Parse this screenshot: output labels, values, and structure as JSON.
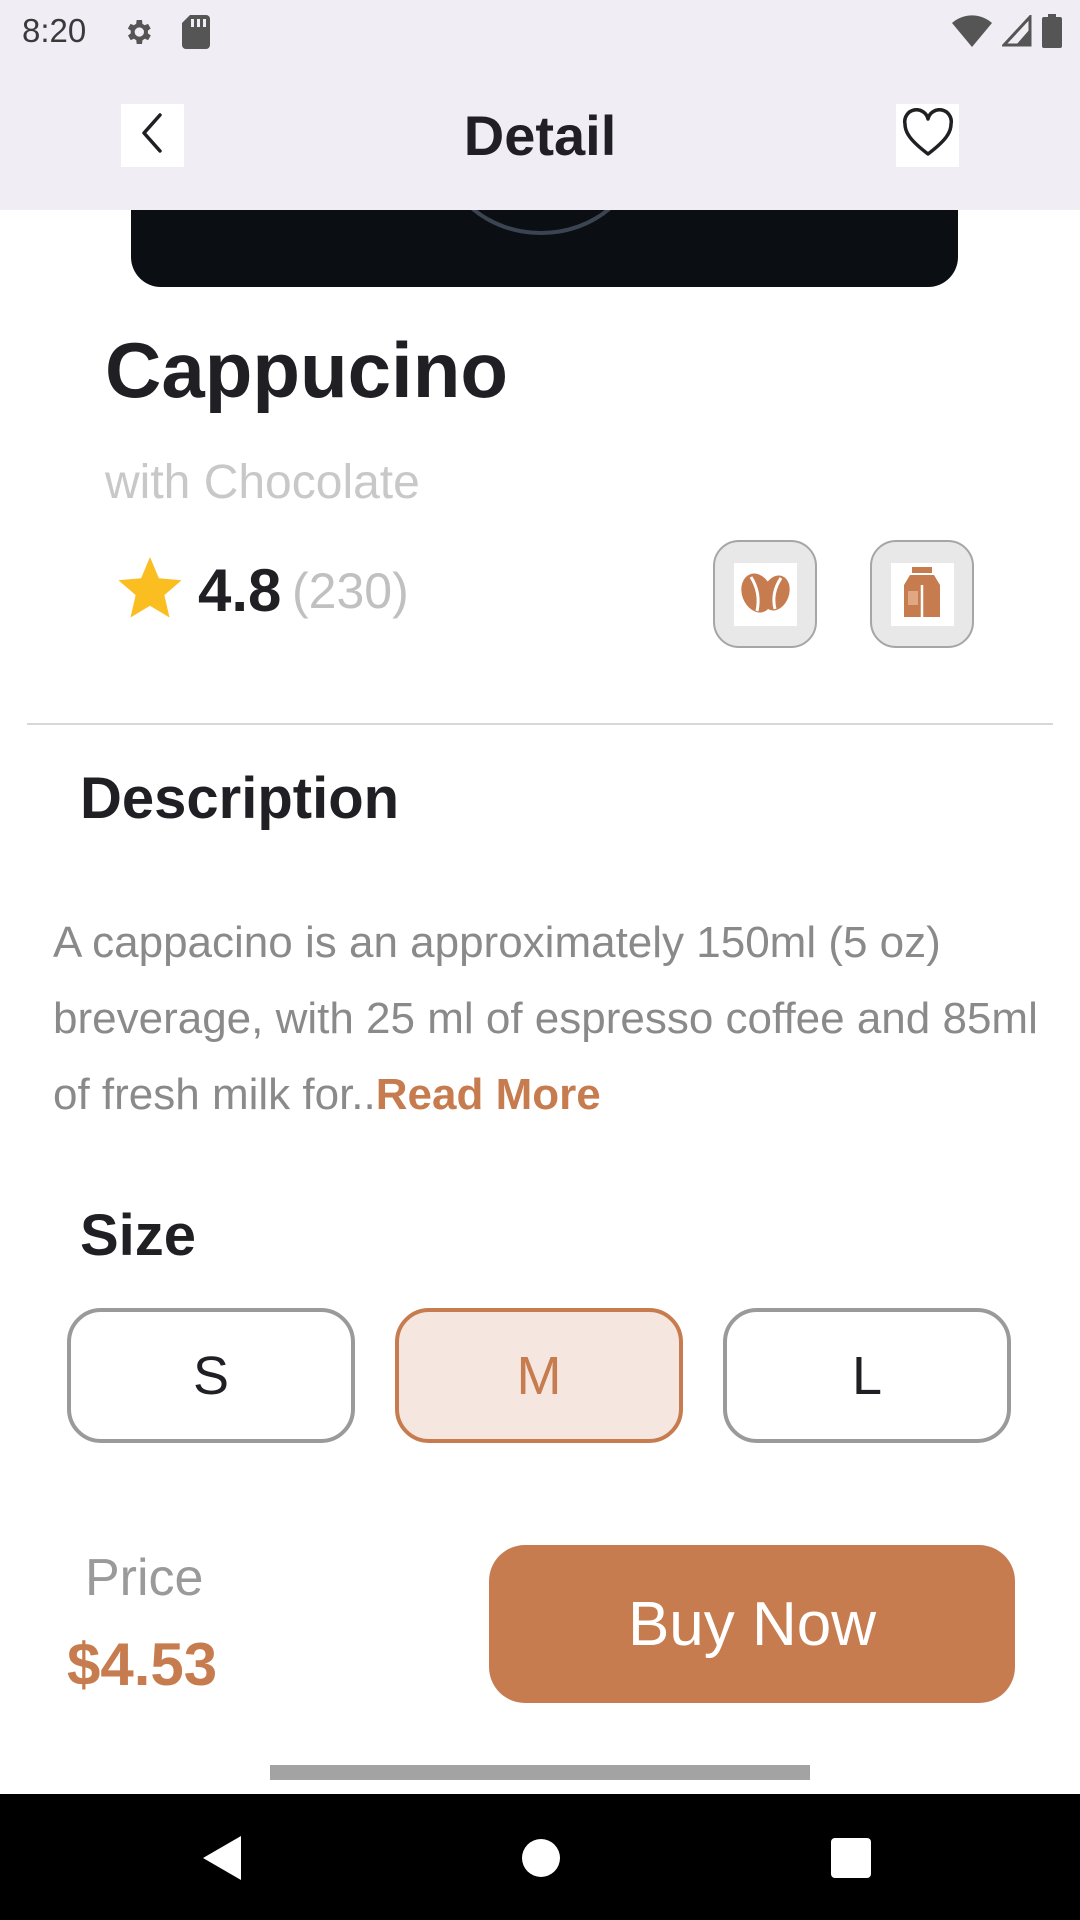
{
  "status_bar": {
    "time": "8:20"
  },
  "app_bar": {
    "title": "Detail"
  },
  "product": {
    "name": "Cappucino",
    "subtitle": "with Chocolate",
    "rating": "4.8",
    "rating_count": "(230)"
  },
  "description": {
    "title": "Description",
    "text": "A cappacino is an approximately 150ml (5 oz) breverage, with 25 ml of espresso coffee and 85ml of fresh milk for..",
    "read_more": "Read More"
  },
  "size": {
    "title": "Size",
    "options": [
      {
        "label": "S",
        "selected": false
      },
      {
        "label": "M",
        "selected": true
      },
      {
        "label": "L",
        "selected": false
      }
    ]
  },
  "price": {
    "label": "Price",
    "value": "$4.53"
  },
  "buy_button": {
    "label": "Buy Now"
  },
  "icons": {
    "back": "back-arrow-icon",
    "favorite": "heart-icon",
    "rating": "star-icon",
    "feature_1": "coffee-bean-icon",
    "feature_2": "milk-carton-icon"
  },
  "colors": {
    "accent": "#c67c4e",
    "accent_light": "#f5e6df",
    "app_bar_bg": "#f1edf4",
    "star": "#fbbe21",
    "text_dark": "#1f1f24"
  }
}
